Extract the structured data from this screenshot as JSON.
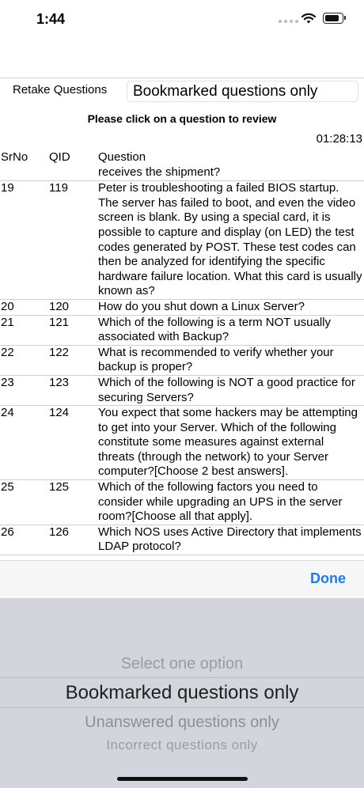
{
  "status_bar": {
    "time": "1:44"
  },
  "header": {
    "retake_label": "Retake Questions",
    "filter_value": "Bookmarked questions only",
    "instruction": "Please click on a question to review",
    "timer": "01:28:13"
  },
  "table": {
    "columns": {
      "srno": "SrNo",
      "qid": "QID",
      "question": "Question"
    },
    "partial_text": "receives the shipment?",
    "rows": [
      {
        "srno": "19",
        "qid": "119",
        "question": "Peter is troubleshooting a failed BIOS startup. The server has failed to boot, and even the video screen is blank. By using a special card, it is possible to capture and display (on LED) the test codes generated by POST. These test codes can then be analyzed for identifying the specific hardware failure location.  What this card is usually known as?"
      },
      {
        "srno": "20",
        "qid": "120",
        "question": "How do you shut down a Linux Server?"
      },
      {
        "srno": "21",
        "qid": "121",
        "question": "Which of the following is a term NOT usually associated with Backup?"
      },
      {
        "srno": "22",
        "qid": "122",
        "question": "What is recommended to verify whether your backup is proper?"
      },
      {
        "srno": "23",
        "qid": "123",
        "question": "Which of the following is NOT a good practice for securing Servers?"
      },
      {
        "srno": "24",
        "qid": "124",
        "question": "You expect that some hackers may be attempting to get into your Server. Which of the following constitute some measures against external threats (through the network) to your Server computer?[Choose 2 best answers]."
      },
      {
        "srno": "25",
        "qid": "125",
        "question": "Which of the following factors you need to consider while upgrading an UPS in the server room?[Choose all that apply]."
      },
      {
        "srno": "26",
        "qid": "126",
        "question": "Which NOS uses Active Directory that implements LDAP protocol?"
      }
    ]
  },
  "toolbar": {
    "done_label": "Done",
    "accent_color": "#1a7cf4"
  },
  "picker": {
    "options": [
      "Select one option",
      "Bookmarked questions only",
      "Unanswered questions only",
      "Incorrect questions only"
    ],
    "selected_index": 1
  }
}
